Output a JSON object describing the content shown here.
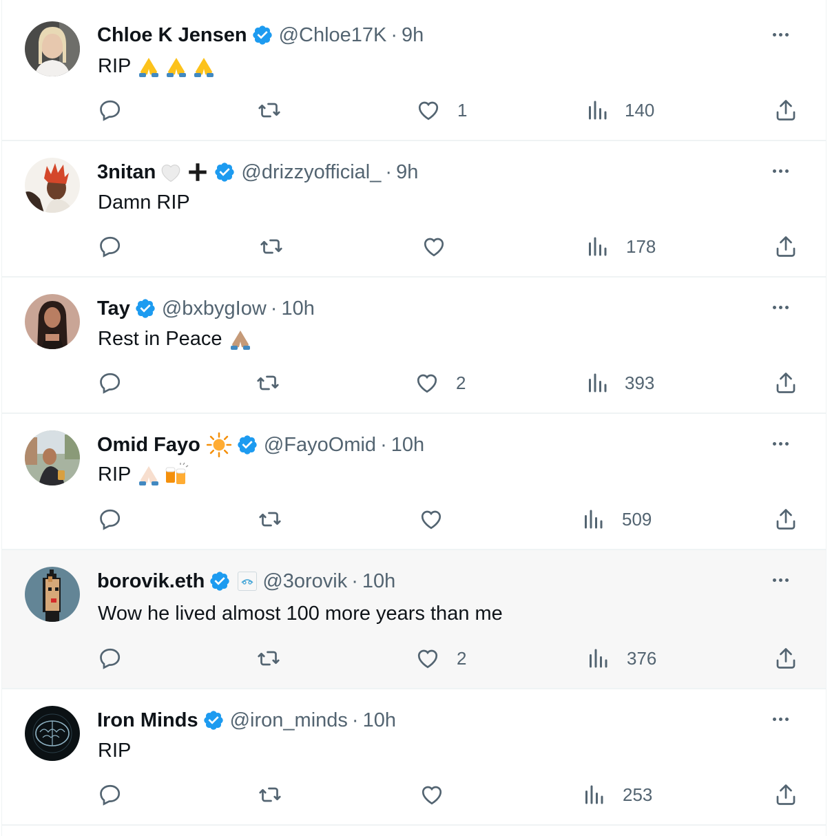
{
  "colors": {
    "verified": "#1d9bf0",
    "muted": "#536471",
    "text": "#0f1419",
    "divider": "#eff3f4",
    "hover_bg": "#f7f7f7"
  },
  "tweets": [
    {
      "name": "Chloe K Jensen",
      "handle": "@Chloe17K",
      "sep": "·",
      "time": "9h",
      "text": "RIP",
      "emoji": "🙏🙏🙏",
      "reply_count": "",
      "retweet_count": "",
      "like_count": "1",
      "view_count": "140"
    },
    {
      "name": "3nitan",
      "name_emoji": "🤍➕",
      "handle": "@drizzyofficial_",
      "sep": "·",
      "time": "9h",
      "text": "Damn RIP",
      "like_count": "",
      "view_count": "178"
    },
    {
      "name": "Tay",
      "handle": "@bxbygIow",
      "sep": "·",
      "time": "10h",
      "text": "Rest in Peace",
      "emoji": "🙏",
      "like_count": "2",
      "view_count": "393"
    },
    {
      "name": "Omid Fayo",
      "name_emoji": "☀️",
      "handle": "@FayoOmid",
      "sep": "·",
      "time": "10h",
      "text": "RIP",
      "emoji": "🙏🍻",
      "like_count": "",
      "view_count": "509"
    },
    {
      "name": "borovik.eth",
      "handle": "@3orovik",
      "sep": "·",
      "time": "10h",
      "text": "Wow he lived almost 100 more years than me",
      "like_count": "2",
      "view_count": "376"
    },
    {
      "name": "Iron Minds",
      "handle": "@iron_minds",
      "sep": "·",
      "time": "10h",
      "text": "RIP",
      "like_count": "",
      "view_count": "253"
    }
  ]
}
